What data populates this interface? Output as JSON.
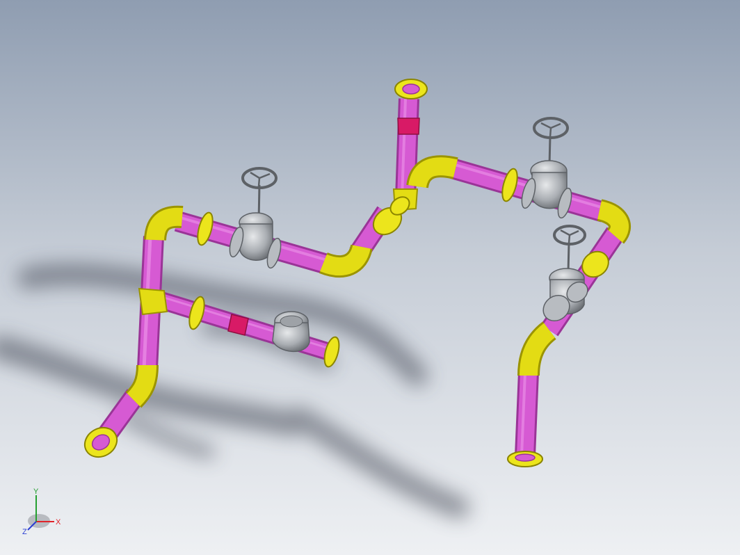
{
  "viewport": {
    "background_top": "#8f9db1",
    "background_mid": "#c5ccd6",
    "background_bottom": "#eef0f3"
  },
  "colors": {
    "pipe": "#d65ad3",
    "pipe_dark": "#9a3497",
    "pipe_light": "#ee9aeb",
    "elbow": "#e3dc14",
    "elbow_dark": "#9b9400",
    "flange": "#ece51c",
    "reducer": "#d81a66",
    "valve_body": "#b8bcc1",
    "valve_dark": "#5d6166",
    "shadow": "#3d4350"
  },
  "triad": {
    "x_label": "X",
    "y_label": "Y",
    "z_label": "Z",
    "x_color": "#e0242a",
    "y_color": "#25a031",
    "z_color": "#2c3fd3"
  },
  "valves": [
    {
      "name": "gate-valve-left",
      "type": "gate-valve-handwheel"
    },
    {
      "name": "gate-valve-top-right",
      "type": "gate-valve-handwheel"
    },
    {
      "name": "gate-valve-right",
      "type": "gate-valve-handwheel"
    },
    {
      "name": "check-valve-branch",
      "type": "check-valve"
    }
  ]
}
